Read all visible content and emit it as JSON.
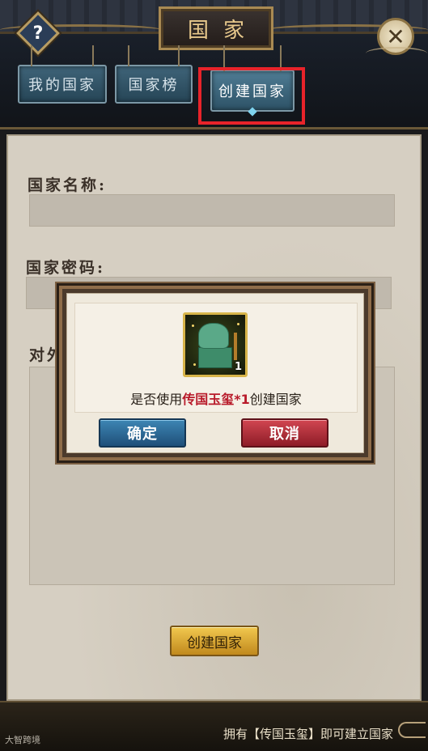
{
  "header": {
    "title": "国家",
    "help_label": "?",
    "close_label": "✕"
  },
  "tabs": [
    {
      "label": "我的国家",
      "active": false
    },
    {
      "label": "国家榜",
      "active": false
    },
    {
      "label": "创建国家",
      "active": true
    }
  ],
  "form": {
    "name_label": "国家名称:",
    "name_value": "",
    "password_label": "国家密码:",
    "password_value": "",
    "notice_label": "对外",
    "notice_value": ""
  },
  "create_button": "创建国家",
  "footer": {
    "hint": "拥有【传国玉玺】即可建立国家",
    "watermark": "大智跨境"
  },
  "dialog": {
    "item_count": "1",
    "prompt_prefix": "是否使用",
    "prompt_item": "传国玉玺",
    "prompt_qty": "*1",
    "prompt_suffix": "创建国家",
    "confirm_label": "确定",
    "cancel_label": "取消"
  },
  "colors": {
    "highlight": "#e8232a",
    "item_name": "#b81a2a",
    "confirm": "#2f6f9e",
    "cancel": "#c0313c",
    "create": "#e0ab35"
  }
}
